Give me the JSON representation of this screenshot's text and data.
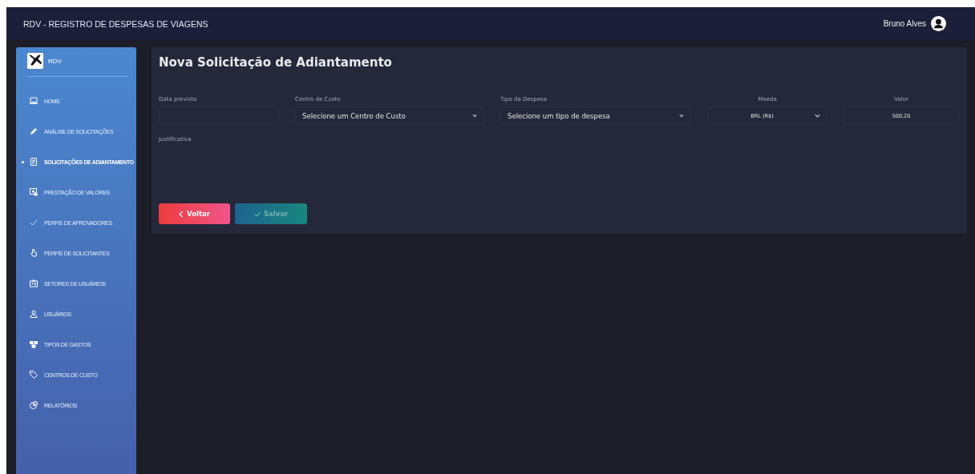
{
  "header": {
    "title": "RDV - REGISTRO DE DESPESAS DE VIAGENS",
    "user": "Bruno Alves"
  },
  "sidebar": {
    "brand": "RDV",
    "items": [
      {
        "label": "HOME",
        "selected": false
      },
      {
        "label": "ANÁLISE DE SOLICITAÇÕES",
        "selected": false
      },
      {
        "label": "SOLICITAÇÕES DE ADIANTAMENTO",
        "selected": true
      },
      {
        "label": "PRESTAÇÃO DE VALORES",
        "selected": false
      },
      {
        "label": "PERFIS DE APROVADORES",
        "selected": false
      },
      {
        "label": "PERFIS DE SOLICITANTES",
        "selected": false
      },
      {
        "label": "SETORES DE USUÁRIOS",
        "selected": false
      },
      {
        "label": "USUÁRIOS",
        "selected": false
      },
      {
        "label": "TIPOS DE GASTOS",
        "selected": false
      },
      {
        "label": "CENTROS DE CUSTO",
        "selected": false
      },
      {
        "label": "RELATÓRIOS",
        "selected": false
      }
    ]
  },
  "form": {
    "title": "Nova Solicitação de Adiantamento",
    "fields": [
      {
        "kind": "input",
        "label": "Data prevista"
      },
      {
        "kind": "select",
        "label": "Centro de Custo",
        "value": "Selecione um Centro de Custo"
      },
      {
        "kind": "select",
        "label": "Tipo da Despesa",
        "value": "Selecione um tipo de despesa"
      },
      {
        "kind": "currency",
        "label": "Moeda",
        "value": "BRL (R$)"
      },
      {
        "kind": "amount",
        "label": "Valor",
        "value": "500,20"
      }
    ],
    "justification": {
      "label": "Justificativa"
    },
    "buttons": [
      {
        "kind": "back",
        "label": "Voltar",
        "disabled": false
      },
      {
        "kind": "save",
        "label": "Salvar",
        "disabled": true
      }
    ]
  }
}
